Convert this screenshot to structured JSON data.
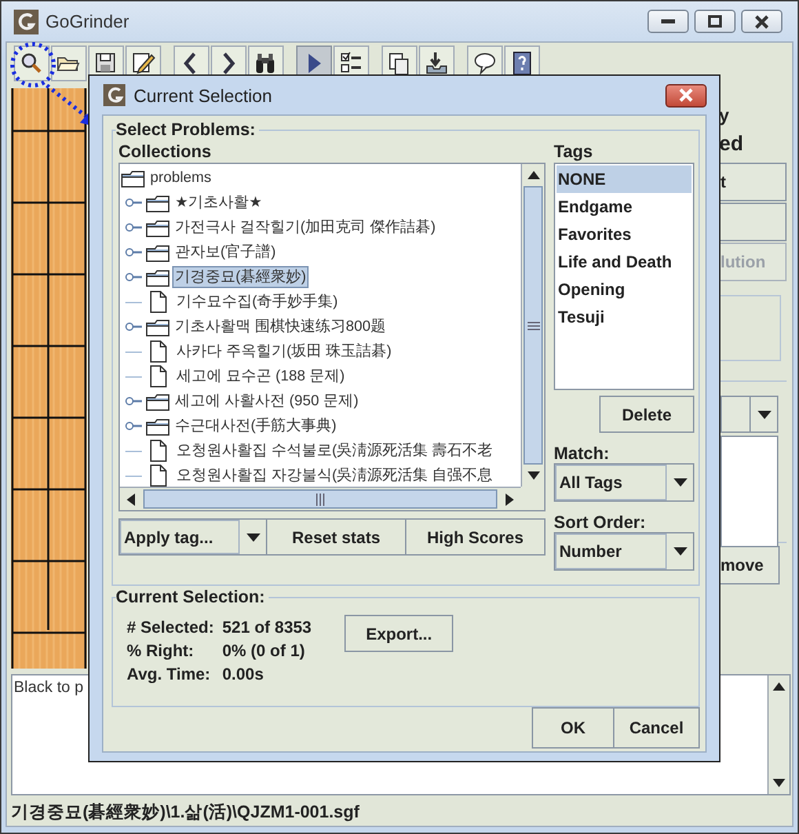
{
  "window": {
    "title": "GoGrinder"
  },
  "toolbar_groups": [
    {
      "buttons": [
        {
          "kind": "search",
          "selected": false
        },
        {
          "kind": "open",
          "selected": false
        },
        {
          "kind": "save",
          "selected": false
        },
        {
          "kind": "edit",
          "selected": false
        }
      ]
    },
    {
      "buttons": [
        {
          "kind": "back",
          "selected": false
        },
        {
          "kind": "forward",
          "selected": false
        },
        {
          "kind": "find",
          "selected": false
        }
      ]
    },
    {
      "buttons": [
        {
          "kind": "play",
          "selected": true
        },
        {
          "kind": "checklist",
          "selected": false
        }
      ]
    },
    {
      "buttons": [
        {
          "kind": "copy",
          "selected": false
        },
        {
          "kind": "import",
          "selected": false
        }
      ]
    },
    {
      "buttons": [
        {
          "kind": "comment",
          "selected": false
        },
        {
          "kind": "help",
          "selected": false
        }
      ]
    }
  ],
  "side_panel": {
    "label": "y",
    "heading": "ed",
    "buttons": [
      {
        "label": "t",
        "disabled": false
      },
      {
        "disabled": false
      },
      {
        "label": "lution",
        "disabled": true
      }
    ],
    "remove_button": "move"
  },
  "comment": "Black to p",
  "status_bar": "기경중묘(碁經衆妙)\\1.삶(活)\\QJZM1-001.sgf",
  "dialog": {
    "title": "Current Selection",
    "select_group": "Select Problems:",
    "collections_label": "Collections",
    "tree": {
      "label": "problems",
      "kind": "folder",
      "selected": false,
      "children": [
        {
          "label": "★기초사활★",
          "kind": "folder",
          "expanded": false,
          "selected": false
        },
        {
          "label": "가전극사 걸작힐기(加田克司 傑作詰碁)",
          "kind": "folder",
          "expanded": false,
          "selected": false
        },
        {
          "label": "관자보(官子譜)",
          "kind": "folder",
          "expanded": false,
          "selected": false
        },
        {
          "label": "기경중묘(碁經衆妙)",
          "kind": "folder",
          "expanded": false,
          "selected": true
        },
        {
          "label": "기수묘수집(奇手妙手集)",
          "kind": "file",
          "selected": false
        },
        {
          "label": "기초사활맥 围棋快速练习800题",
          "kind": "folder",
          "expanded": false,
          "selected": false
        },
        {
          "label": "사카다 주옥힐기(坂田 珠玉詰碁)",
          "kind": "file",
          "selected": false
        },
        {
          "label": "세고에 묘수곤 (188 문제)",
          "kind": "file",
          "selected": false
        },
        {
          "label": "세고에 사활사전 (950 문제)",
          "kind": "folder",
          "expanded": false,
          "selected": false
        },
        {
          "label": "수근대사전(手筋大事典)",
          "kind": "folder",
          "expanded": false,
          "selected": false
        },
        {
          "label": "오청원사활집 수석불로(吳淸源死活集 壽石不老",
          "kind": "file",
          "selected": false
        },
        {
          "label": "오청원사활집 자강불식(吳淸源死活集 自强不息",
          "kind": "file",
          "selected": false
        }
      ]
    },
    "action_buttons": [
      {
        "label": "Apply tag...",
        "kind": "split"
      },
      {
        "label": "Reset stats",
        "kind": "button"
      },
      {
        "label": "High Scores",
        "kind": "button"
      }
    ],
    "tags_label": "Tags",
    "tags": [
      {
        "label": "NONE",
        "selected": true
      },
      {
        "label": "Endgame",
        "selected": false
      },
      {
        "label": "Favorites",
        "selected": false
      },
      {
        "label": "Life and Death",
        "selected": false
      },
      {
        "label": "Opening",
        "selected": false
      },
      {
        "label": "Tesuji",
        "selected": false
      }
    ],
    "delete_button": "Delete",
    "match": {
      "label": "Match:",
      "value": "All Tags"
    },
    "sort": {
      "label": "Sort Order:",
      "value": "Number"
    },
    "stats_group": "Current Selection:",
    "stats": [
      {
        "label": "# Selected:",
        "value": "521 of 8353"
      },
      {
        "label": "% Right:",
        "value": "0% (0 of 1)"
      },
      {
        "label": "Avg. Time:",
        "value": "0.00s"
      }
    ],
    "export_button": "Export...",
    "buttons": [
      "OK",
      "Cancel"
    ]
  }
}
